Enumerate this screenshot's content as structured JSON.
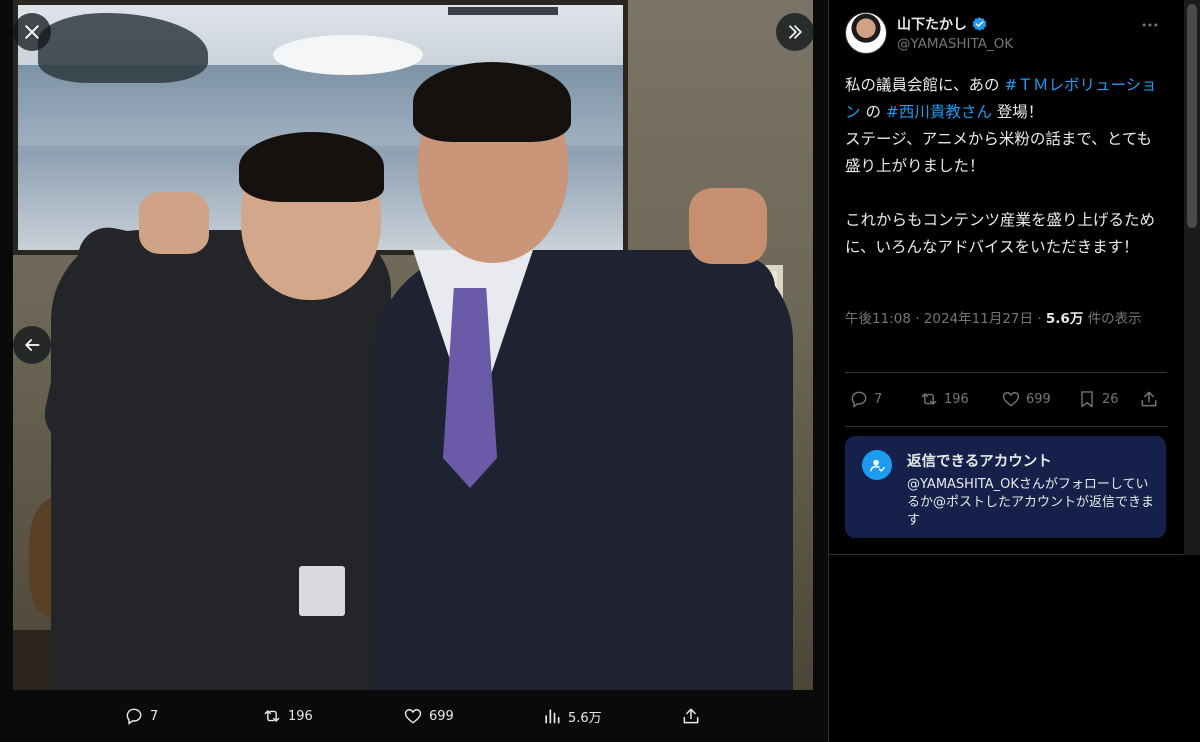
{
  "viewer": {
    "actions": {
      "reply_count": "7",
      "repost_count": "196",
      "like_count": "699",
      "views_count": "5.6万"
    }
  },
  "tweet": {
    "author": {
      "display_name": "山下たかし",
      "handle": "@YAMASHITA_OK",
      "verified": true
    },
    "body_parts": [
      {
        "text": "私の議員会館に、あの ",
        "tag": false
      },
      {
        "text": "#ＴＭレボリューション",
        "tag": true
      },
      {
        "text": " の ",
        "tag": false
      },
      {
        "text": "#西川貴教さん",
        "tag": true
      },
      {
        "text": " 登場！\nステージ、アニメから米粉の話まで、とても盛り上がりました！\n\nこれからもコンテンツ産業を盛り上げるために、いろんなアドバイスをいただきます！",
        "tag": false
      }
    ],
    "meta": {
      "time": "午後11:08",
      "separator": "·",
      "date": "2024年11月27日",
      "views_number": "5.6万",
      "views_suffix": "件の表示"
    },
    "stats": {
      "replies": "7",
      "reposts": "196",
      "likes": "699",
      "bookmarks": "26"
    },
    "reply_restriction": {
      "title": "返信できるアカウント",
      "description": "@YAMASHITA_OKさんがフォローしているか@ポストしたアカウントが返信できます"
    }
  },
  "colors": {
    "accent": "#1d9bf0",
    "background": "#000000",
    "muted_text": "#71767b",
    "card_background": "#15214a"
  }
}
